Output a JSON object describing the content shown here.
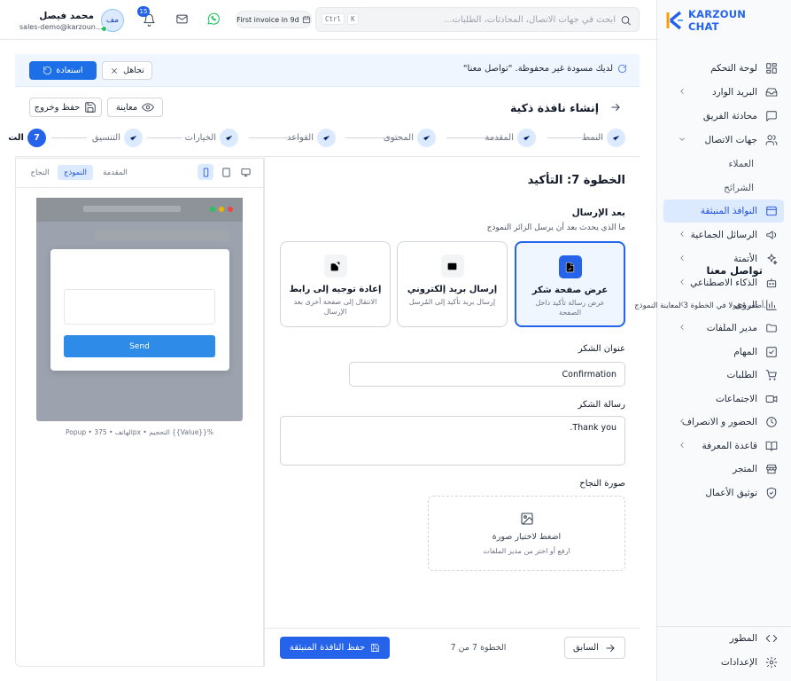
{
  "brand": {
    "name": "KARZOUN CHAT"
  },
  "sidebar": {
    "items": [
      {
        "label": "لوحة التحكم",
        "icon": "dashboard-icon"
      },
      {
        "label": "البريد الوارد",
        "icon": "inbox-icon"
      },
      {
        "label": "محادثة الفريق",
        "icon": "team-chat-icon"
      },
      {
        "label": "جهات الاتصال",
        "icon": "contacts-icon"
      },
      {
        "label": "العملاء"
      },
      {
        "label": "الشرائح"
      },
      {
        "label": "النوافذ المنبثقة",
        "icon": "popup-window-icon"
      },
      {
        "label": "الرسائل الجماعية",
        "icon": "megaphone-icon"
      },
      {
        "label": "الأتمتة",
        "icon": "sparkles-icon"
      },
      {
        "label": "الذكاء الاصطناعي",
        "icon": "bot-icon"
      },
      {
        "label": "الرؤى",
        "icon": "bar-chart-icon"
      },
      {
        "label": "مدير الملفات",
        "icon": "folder-icon"
      },
      {
        "label": "المهام",
        "icon": "checkbox-icon"
      },
      {
        "label": "الطلبات",
        "icon": "cart-icon"
      },
      {
        "label": "الاجتماعات",
        "icon": "video-icon"
      },
      {
        "label": "الحضور و الانصراف",
        "icon": "clock-icon"
      },
      {
        "label": "قاعدة المعرفة",
        "icon": "book-icon"
      },
      {
        "label": "المتجر",
        "icon": "store-icon"
      },
      {
        "label": "توثيق الأعمال",
        "icon": "shield-check-icon"
      }
    ],
    "bottom": [
      {
        "label": "المطور",
        "icon": "code-icon"
      },
      {
        "label": "الإعدادات",
        "icon": "settings-icon"
      }
    ]
  },
  "topbar": {
    "search_placeholder": "ابحث في جهات الاتصال، المحادثات، الطلبات...",
    "kbd": [
      "Ctrl",
      "K"
    ],
    "invoice": "First invoice in 9d",
    "notifications": "15",
    "avatar": "مف",
    "user_name": "محمد فيصل",
    "user_email": "sales-demo@karzoun..."
  },
  "banner": {
    "text": "لديك مسودة غير محفوظة. \"تواصل معنا\"",
    "restore": "استعادة",
    "ignore": "تجاهل"
  },
  "header": {
    "title": "إنشاء نافذة ذكية",
    "preview": "معاينة",
    "save_exit": "حفظ وخروج"
  },
  "steps": [
    {
      "label": "النمط",
      "done": true
    },
    {
      "label": "المقدمة",
      "done": true
    },
    {
      "label": "المحتوى",
      "done": true
    },
    {
      "label": "القواعد",
      "done": true
    },
    {
      "label": "الخيارات",
      "done": true
    },
    {
      "label": "التنسيق",
      "done": true
    },
    {
      "label": "الت",
      "number": "7",
      "current": true
    }
  ],
  "form": {
    "heading": "الخطوة 7: التأكيد",
    "after_title": "بعد الإرسال",
    "after_desc": "ما الذي يحدث بعد أن يرسل الزائر النموذج",
    "options": [
      {
        "title": "عرض صفحة شكر",
        "desc": "عرض رسالة تأكيد داخل الصفحة",
        "icon": "file-check-icon",
        "selected": true
      },
      {
        "title": "إرسال بريد إلكتروني",
        "desc": "إرسال بريد تأكيد إلى المُرسل",
        "icon": "mail-icon",
        "selected": false
      },
      {
        "title": "إعادة توجيه إلى رابط",
        "desc": "الانتقال إلى صفحة أخرى بعد الإرسال",
        "icon": "external-link-icon",
        "selected": false
      }
    ],
    "ty_title_label": "عنوان الشكر",
    "ty_title_value": "Confirmation",
    "ty_msg_label": "رسالة الشكر",
    "ty_msg_value": "Thank you.",
    "image_label": "صورة النجاح",
    "upload_title": "اضغط لاختيار صورة",
    "upload_sub": "ارفع أو اختر من مدير الملفات"
  },
  "footer": {
    "prev": "السابق",
    "step_count": "الخطوة 7 من 7",
    "save": "حفظ النافذة المنبثقة"
  },
  "preview": {
    "tabs": [
      "المقدمة",
      "النموذج",
      "النجاح"
    ],
    "active_tab": "النموذج",
    "modal_title": "تواصل معنا",
    "modal_text": "أضف حقولا في الخطوة 3 لمعاينة النموذج.",
    "send": "Send",
    "caption": "Popup • الهاتف • 375px • التحجيم {{Value}}%"
  }
}
